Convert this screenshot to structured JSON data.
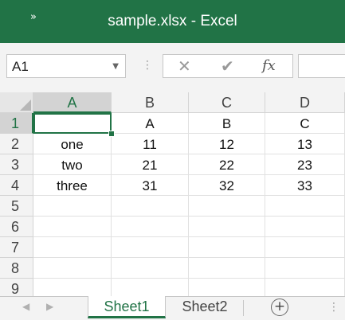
{
  "window": {
    "title": "sample.xlsx  -  Excel",
    "quick_access_icon": "»"
  },
  "formula_bar": {
    "name_box": "A1",
    "cancel_icon": "✕",
    "enter_icon": "✔",
    "fx_label": "fx",
    "formula": ""
  },
  "grid": {
    "columns": [
      "A",
      "B",
      "C",
      "D"
    ],
    "rows": [
      "1",
      "2",
      "3",
      "4",
      "5",
      "6",
      "7",
      "8",
      "9"
    ],
    "cells": [
      [
        "",
        "A",
        "B",
        "C"
      ],
      [
        "one",
        "11",
        "12",
        "13"
      ],
      [
        "two",
        "21",
        "22",
        "23"
      ],
      [
        "three",
        "31",
        "32",
        "33"
      ],
      [
        "",
        "",
        "",
        ""
      ],
      [
        "",
        "",
        "",
        ""
      ],
      [
        "",
        "",
        "",
        ""
      ],
      [
        "",
        "",
        "",
        ""
      ],
      [
        "",
        "",
        "",
        ""
      ]
    ],
    "active_cell": "A1"
  },
  "sheets": {
    "tabs": [
      {
        "label": "Sheet1",
        "active": true
      },
      {
        "label": "Sheet2",
        "active": false
      }
    ],
    "add_label": "+"
  },
  "colors": {
    "accent": "#217346",
    "header_bg": "#f3f3f3",
    "gridline": "#e1e1e1"
  }
}
